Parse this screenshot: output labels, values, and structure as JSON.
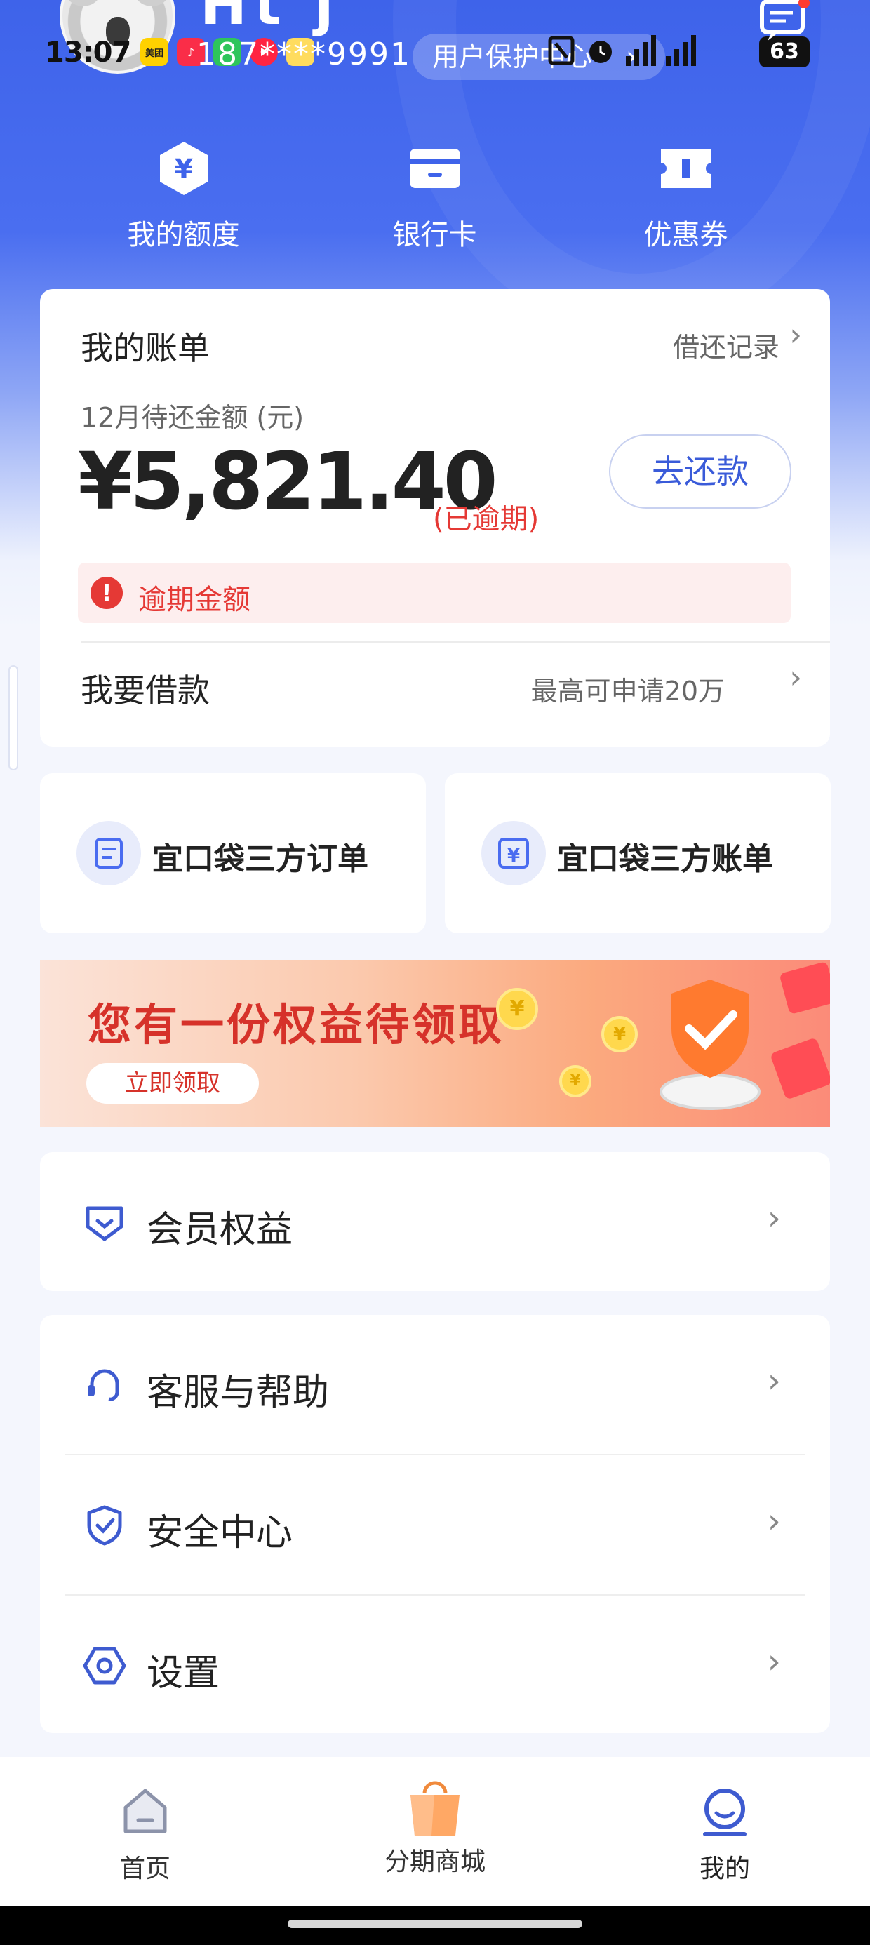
{
  "status_bar": {
    "time": "13:07",
    "app_badges": [
      "美团",
      "♪",
      "",
      "",
      ""
    ],
    "battery": "63"
  },
  "profile": {
    "name": "Ht  j",
    "phone": "187****9991",
    "protect_center": "用户保护中心",
    "protect_chevron": "›"
  },
  "quick_nav": [
    {
      "label": "我的额度",
      "icon": "yuan-hexagon-icon"
    },
    {
      "label": "银行卡",
      "icon": "bank-card-icon"
    },
    {
      "label": "优惠券",
      "icon": "coupon-icon"
    }
  ],
  "bill": {
    "title": "我的账单",
    "records_link": "借还记录",
    "due_label": "12月待还金额 (元)",
    "amount": "¥5,821.40",
    "overdue_tag": "(已逾期)",
    "pay_button": "去还款",
    "overdue_notice": "逾期金额",
    "borrow_label": "我要借款",
    "borrow_hint": "最高可申请20万"
  },
  "third_party": [
    {
      "label": "宜口袋三方订单",
      "icon": "order-doc-icon"
    },
    {
      "label": "宜口袋三方账单",
      "icon": "yuan-bill-icon"
    }
  ],
  "banner": {
    "title": "您有一份权益待领取",
    "button": "立即领取"
  },
  "menu_single": {
    "label": "会员权益",
    "icon": "member-badge-icon"
  },
  "menu_group": [
    {
      "label": "客服与帮助",
      "icon": "headset-icon"
    },
    {
      "label": "安全中心",
      "icon": "shield-check-icon"
    },
    {
      "label": "设置",
      "icon": "settings-hexagon-icon"
    }
  ],
  "chevron": "›",
  "tab_bar": [
    {
      "label": "首页",
      "icon": "home-icon"
    },
    {
      "label": "分期商城",
      "icon": "shopping-bag-icon"
    },
    {
      "label": "我的",
      "icon": "profile-icon"
    }
  ],
  "colors": {
    "brand_blue": "#3e63ea",
    "overdue_red": "#e53935",
    "pay_button_text": "#3a5bd9"
  }
}
